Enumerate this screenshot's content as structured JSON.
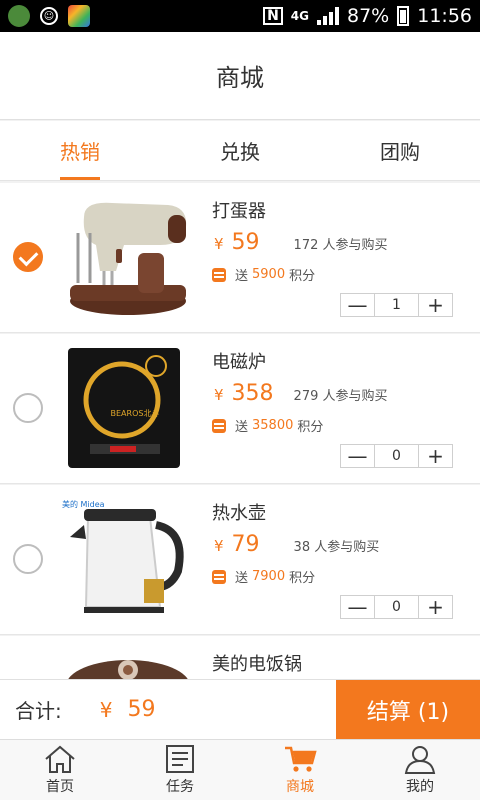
{
  "status_bar": {
    "network": "4G",
    "battery": "87%",
    "time": "11:56"
  },
  "title": "商城",
  "tabs": [
    {
      "label": "热销",
      "active": true
    },
    {
      "label": "兑换",
      "active": false
    },
    {
      "label": "团购",
      "active": false
    }
  ],
  "products": [
    {
      "name": "打蛋器",
      "currency": "¥",
      "price": "59",
      "buyers": "172 人参与购买",
      "points_prefix": "送",
      "points": "5900",
      "points_suffix": "积分",
      "quantity": "1",
      "checked": true
    },
    {
      "name": "电磁炉",
      "currency": "¥",
      "price": "358",
      "buyers": "279 人参与购买",
      "points_prefix": "送",
      "points": "35800",
      "points_suffix": "积分",
      "quantity": "0",
      "checked": false,
      "brand_text": "BEAROS北斗"
    },
    {
      "name": "热水壶",
      "currency": "¥",
      "price": "79",
      "buyers": "38 人参与购买",
      "points_prefix": "送",
      "points": "7900",
      "points_suffix": "积分",
      "quantity": "0",
      "checked": false,
      "brand_text": "美的 Midea"
    },
    {
      "name": "美的电饭锅"
    }
  ],
  "stepper": {
    "minus": "—",
    "plus": "+"
  },
  "total": {
    "label": "合计:",
    "currency": "¥",
    "value": "59",
    "checkout_label": "结算 (1)"
  },
  "nav": [
    {
      "label": "首页",
      "icon": "home-icon",
      "active": false
    },
    {
      "label": "任务",
      "icon": "task-icon",
      "active": false
    },
    {
      "label": "商城",
      "icon": "cart-icon",
      "active": true
    },
    {
      "label": "我的",
      "icon": "user-icon",
      "active": false
    }
  ],
  "colors": {
    "accent": "#f3781e",
    "text": "#333333",
    "background": "#f2f2f2"
  }
}
